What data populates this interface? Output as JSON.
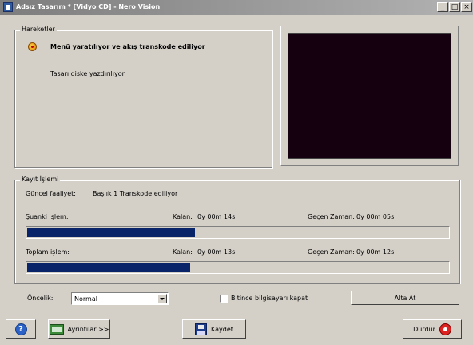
{
  "window": {
    "title": "Adsız Tasarım * [Vidyo CD] - Nero Vision",
    "controls": {
      "minimize": "_",
      "maximize": "□",
      "close": "×"
    }
  },
  "activities": {
    "legend": "Hareketler",
    "current_task": "Menü yaratılıyor ve akış transkode ediliyor",
    "sub_task": "Tasarı diske yazdırılıyor"
  },
  "record_process": {
    "legend": "Kayıt İşlemi",
    "current_activity_label": "Güncel faaliyet:",
    "current_activity_value": "Başlık 1 Transkode ediliyor",
    "current_step": {
      "label": "Şuanki işlem:",
      "remaining_label": "Kalan:",
      "remaining_value": "0y 00m 14s",
      "elapsed_label": "Geçen Zaman:",
      "elapsed_value": "0y 00m 05s",
      "progress_percent": 40
    },
    "total": {
      "label": "Toplam işlem:",
      "remaining_label": "Kalan:",
      "remaining_value": "0y 00m 13s",
      "elapsed_label": "Geçen Zaman:",
      "elapsed_value": "0y 00m 12s",
      "progress_percent": 39
    }
  },
  "options": {
    "priority_label": "Öncelik:",
    "priority_value": "Normal",
    "shutdown_label": "Bitince bilgisayarı kapat",
    "shutdown_checked": false,
    "minimize_button": "Alta At"
  },
  "footer": {
    "help_icon": "question-icon",
    "details_button": "Ayrıntılar >>",
    "save_button": "Kaydet",
    "stop_button": "Durdur"
  },
  "colors": {
    "progress_fill": "#0a246a",
    "preview_bg": "#150010",
    "dialog_bg": "#d4d0c8"
  }
}
